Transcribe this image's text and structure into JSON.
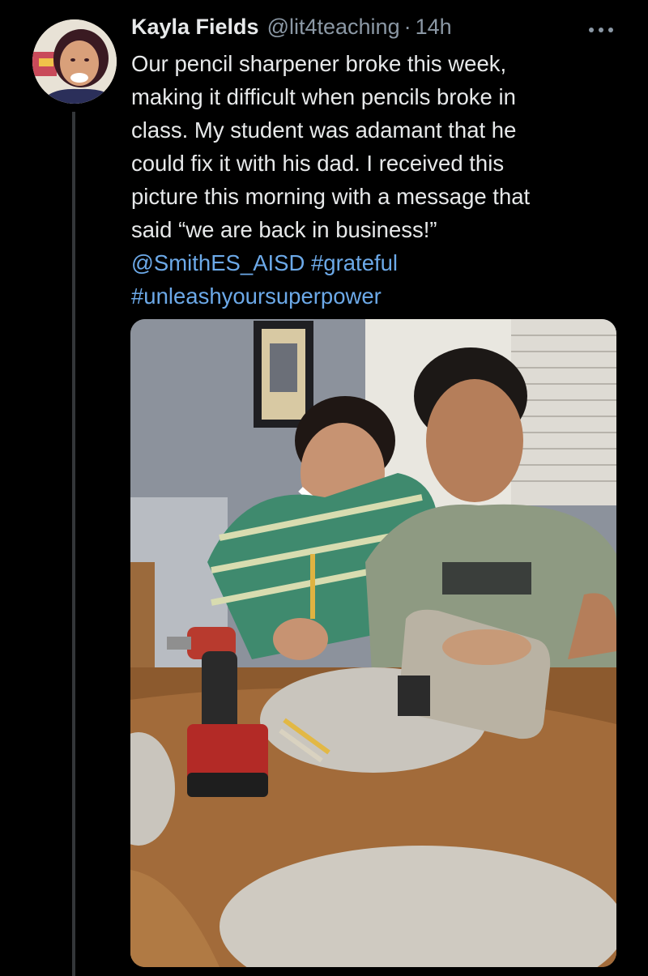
{
  "tweet": {
    "author_name": "Kayla Fields",
    "author_handle": "@lit4teaching",
    "separator": "·",
    "time_ago": "14h",
    "body_lines": [
      "Our pencil sharpener broke this week,",
      "making it difficult when pencils broke in",
      "class. My student was adamant that he",
      "could fix it with his dad. I received this",
      "picture this morning with a message that",
      "said “we are back in business!”"
    ],
    "mention": "@SmithES_AISD",
    "hashtag_1": "#grateful",
    "hashtag_2": "#unleashyoursuperpower"
  },
  "icons": {
    "more": "more-horizontal-icon"
  },
  "colors": {
    "background": "#000000",
    "text": "#e7e9ea",
    "secondary_text": "#8b98a5",
    "link": "#6ca9e8",
    "thread_line": "#333639"
  }
}
